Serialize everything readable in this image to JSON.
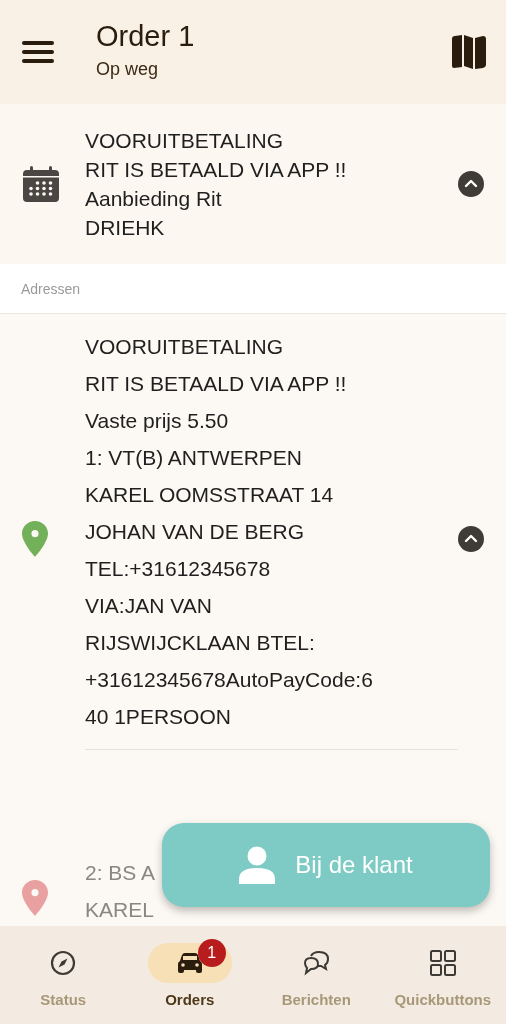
{
  "header": {
    "title": "Order 1",
    "subtitle": "Op weg"
  },
  "info": {
    "lines": [
      "VOORUITBETALING",
      "RIT IS BETAALD VIA APP !!",
      "Aanbieding Rit",
      "DRIEHK"
    ],
    "expanded": true
  },
  "section_label": "Adressen",
  "addresses": [
    {
      "color": "#72b05a",
      "muted": false,
      "expanded": true,
      "lines": [
        "VOORUITBETALING",
        "RIT IS BETAALD VIA APP !!",
        "Vaste prijs 5.50",
        "1: VT(B) ANTWERPEN",
        "KAREL OOMSSTRAAT 14",
        "JOHAN VAN DE BERG",
        "TEL:+31612345678",
        "VIA:JAN VAN",
        "RIJSWIJCKLAAN BTEL:",
        "+31612345678AutoPayCode:6",
        "40 1PERSOON"
      ]
    },
    {
      "color": "#e8a0a0",
      "muted": true,
      "lines": [
        "2: BS A",
        "KAREL"
      ]
    }
  ],
  "fab": {
    "label": "Bij de klant"
  },
  "nav": [
    {
      "kind": "compass",
      "label": "Status",
      "selected": false
    },
    {
      "kind": "car",
      "label": "Orders",
      "selected": true,
      "badge": "1"
    },
    {
      "kind": "chat",
      "label": "Berichten",
      "selected": false
    },
    {
      "kind": "grid",
      "label": "Quickbuttons",
      "selected": false
    }
  ]
}
